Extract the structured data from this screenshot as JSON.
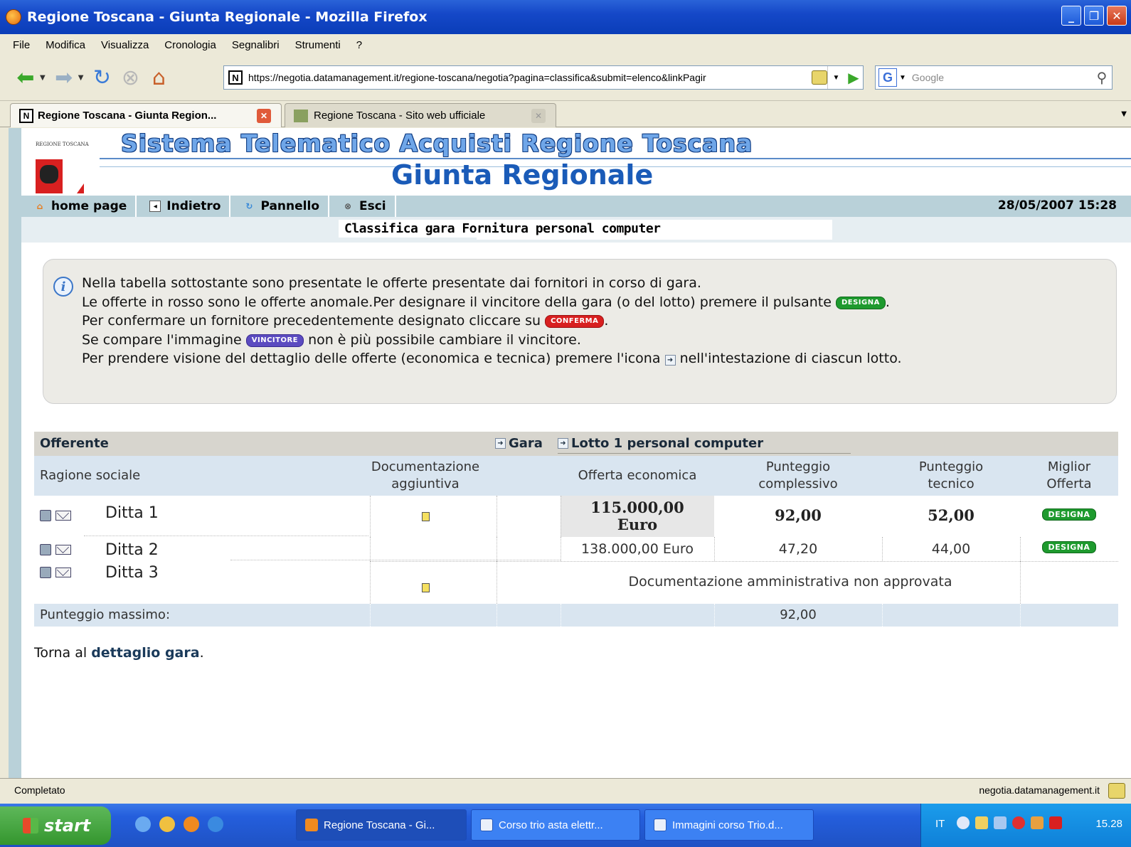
{
  "window": {
    "title": "Regione Toscana - Giunta Regionale - Mozilla Firefox",
    "controls": [
      "_",
      "❐",
      "✕"
    ]
  },
  "menu": [
    "File",
    "Modifica",
    "Visualizza",
    "Cronologia",
    "Segnalibri",
    "Strumenti",
    "?"
  ],
  "toolbar": {
    "url": "https://negotia.datamanagement.it/regione-toscana/negotia?pagina=classifica&submit=elenco&linkPagir",
    "search_placeholder": "Google"
  },
  "tabs": [
    {
      "label": "Regione Toscana - Giunta Region...",
      "active": true
    },
    {
      "label": "Regione Toscana - Sito web ufficiale",
      "active": false
    }
  ],
  "header": {
    "logo_text": "REGIONE TOSCANA",
    "site_title": "Sistema Telematico Acquisti Regione Toscana",
    "subtitle": "Giunta Regionale"
  },
  "nav": {
    "home": "home page",
    "back": "Indietro",
    "panel": "Pannello",
    "exit": "Esci",
    "datetime": "28/05/2007 15:28"
  },
  "page": {
    "title": "Classifica gara Fornitura personal computer"
  },
  "info": {
    "line1": "Nella tabella sottostante sono presentate le offerte presentate dai fornitori in corso di gara.",
    "line2_pre": "Le offerte in rosso sono le offerte anomale.Per designare il vincitore della gara (o del lotto) premere il pulsante",
    "line2_post": ".",
    "line3_pre": "Per confermare un fornitore precedentemente designato cliccare su",
    "line3_post": ".",
    "line4_pre": "Se compare l'immagine",
    "line4_post": "non è più possibile cambiare il vincitore.",
    "line5_pre": "Per prendere visione del dettaglio delle offerte (economica e tecnica) premere l'icona",
    "line5_post": "nell'intestazione di ciascun lotto.",
    "badge_designa": "DESIGNA",
    "badge_conferma": "CONFERMA",
    "badge_vincitore": "VINCITORE"
  },
  "table": {
    "group_header": {
      "offerente": "Offerente",
      "gara": "Gara",
      "lotto": "Lotto 1 personal computer"
    },
    "columns": {
      "ragione": "Ragione sociale",
      "doc_1": "Documentazione",
      "doc_2": "aggiuntiva",
      "offerta": "Offerta economica",
      "pc_1": "Punteggio",
      "pc_2": "complessivo",
      "pt_1": "Punteggio",
      "pt_2": "tecnico",
      "mo_1": "Miglior",
      "mo_2": "Offerta"
    },
    "rows": [
      {
        "name": "Ditta 1",
        "offerta_1": "115.000,00",
        "offerta_2": "Euro",
        "complessivo": "92,00",
        "tecnico": "52,00",
        "action": "DESIGNA"
      },
      {
        "name": "Ditta 2",
        "offerta": "138.000,00 Euro",
        "complessivo": "47,20",
        "tecnico": "44,00",
        "action": "DESIGNA"
      },
      {
        "name": "Ditta 3",
        "note": "Documentazione amministrativa non approvata"
      }
    ],
    "footer": {
      "label": "Punteggio massimo:",
      "value": "92,00"
    }
  },
  "back_link": {
    "pre": "Torna al",
    "link": "dettaglio gara",
    "post": "."
  },
  "status": {
    "left": "Completato",
    "right": "negotia.datamanagement.it"
  },
  "taskbar": {
    "start": "start",
    "tasks": [
      "Regione Toscana - Gi...",
      "Corso trio asta elettr...",
      "Immagini corso Trio.d..."
    ],
    "lang": "IT",
    "clock": "15.28"
  }
}
